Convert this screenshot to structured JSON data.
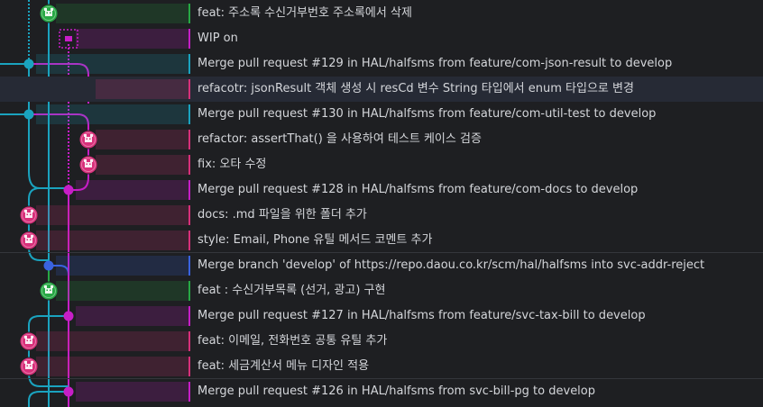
{
  "commits": [
    {
      "message": "feat: 주소록 수신거부번호 주소록에서 삭제",
      "lane": 1,
      "node": "avatar",
      "color": "#27a844"
    },
    {
      "message": "WIP on",
      "lane": 2,
      "node": "wip",
      "color": "#c71ec7"
    },
    {
      "message": "Merge pull request #129 in HAL/halfsms from feature/com-json-result to develop",
      "lane": 0,
      "node": "dot",
      "color": "#1aa3bf"
    },
    {
      "message": "refacotr: jsonResult 객체 생성 시 resCd 변수 String 타입에서 enum 타입으로 변경",
      "lane": 3,
      "node": "avatar",
      "color": "#d8307a",
      "selected": true
    },
    {
      "message": "Merge pull request #130 in HAL/halfsms from feature/com-util-test to develop",
      "lane": 0,
      "node": "dot",
      "color": "#1aa3bf"
    },
    {
      "message": "refactor: assertThat() 을 사용하여 테스트 케이스 검증",
      "lane": 3,
      "node": "avatar",
      "color": "#d8307a"
    },
    {
      "message": "fix: 오타 수정",
      "lane": 3,
      "node": "avatar",
      "color": "#d8307a"
    },
    {
      "message": "Merge pull request #128 in HAL/halfsms from feature/com-docs to develop",
      "lane": 2,
      "node": "dot",
      "color": "#c71ec7"
    },
    {
      "message": "docs: .md 파일을 위한 폴더 추가",
      "lane": 0,
      "node": "avatar",
      "color": "#d8307a"
    },
    {
      "message": "style: Email, Phone 유틸 메서드 코멘트 추가",
      "lane": 0,
      "node": "avatar",
      "color": "#d8307a"
    },
    {
      "message": "Merge branch 'develop' of https://repo.daou.co.kr/scm/hal/halfsms into svc-addr-reject",
      "lane": 1,
      "node": "dot",
      "color": "#3a63e0"
    },
    {
      "message": "feat : 수신거부목록 (선거, 광고) 구현",
      "lane": 1,
      "node": "avatar",
      "color": "#27a844"
    },
    {
      "message": "Merge pull request #127 in HAL/halfsms from feature/svc-tax-bill to develop",
      "lane": 2,
      "node": "dot",
      "color": "#c71ec7"
    },
    {
      "message": "feat: 이메일, 전화번호 공통 유틸 추가",
      "lane": 0,
      "node": "avatar",
      "color": "#d8307a"
    },
    {
      "message": "feat: 세금계산서 메뉴 디자인 적용",
      "lane": 0,
      "node": "avatar",
      "color": "#d8307a"
    },
    {
      "message": "Merge pull request #126 in HAL/halfsms from svc-bill-pg to develop",
      "lane": 2,
      "node": "dot",
      "color": "#c71ec7"
    }
  ],
  "colors": {
    "cyan": "#1aa3bf",
    "magenta": "#c71ec7",
    "green": "#27a844",
    "blue": "#3a63e0",
    "pink": "#d8307a",
    "text": "#d4d6da"
  }
}
